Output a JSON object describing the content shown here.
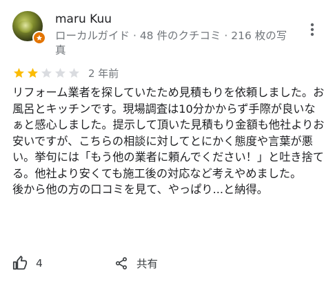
{
  "reviewer": {
    "name": "maru Kuu",
    "meta": "ローカルガイド · 48 件のクチコミ · 216 枚の写真",
    "avatar_icon": "avatar-photo",
    "badge_icon": "local-guide-star-icon",
    "badge_color": "#e37400"
  },
  "rating": {
    "value": 2,
    "max": 5,
    "filled_color": "#fbbc04",
    "empty_color": "#dadce0",
    "time_ago": "2 年前"
  },
  "review_text": "リフォーム業者を探していたため見積もりを依頼しました。お風呂とキッチンです。現場調査は10分かからず手際が良いなぁと感心しました。提示して頂いた見積もり金額も他社よりお安いですが、こちらの相談に対してとにかく態度や言葉が悪い。挙句には「もう他の業者に頼んでください！」と吐き捨てる。他社より安くても施工後の対応など考えやめました。\n後から他の方の口コミを見て、やっぱり...と納得。",
  "actions": {
    "like_icon": "thumbs-up-icon",
    "like_count": "4",
    "share_icon": "share-icon",
    "share_label": "共有"
  },
  "menu": {
    "more_icon": "more-vert-icon"
  }
}
